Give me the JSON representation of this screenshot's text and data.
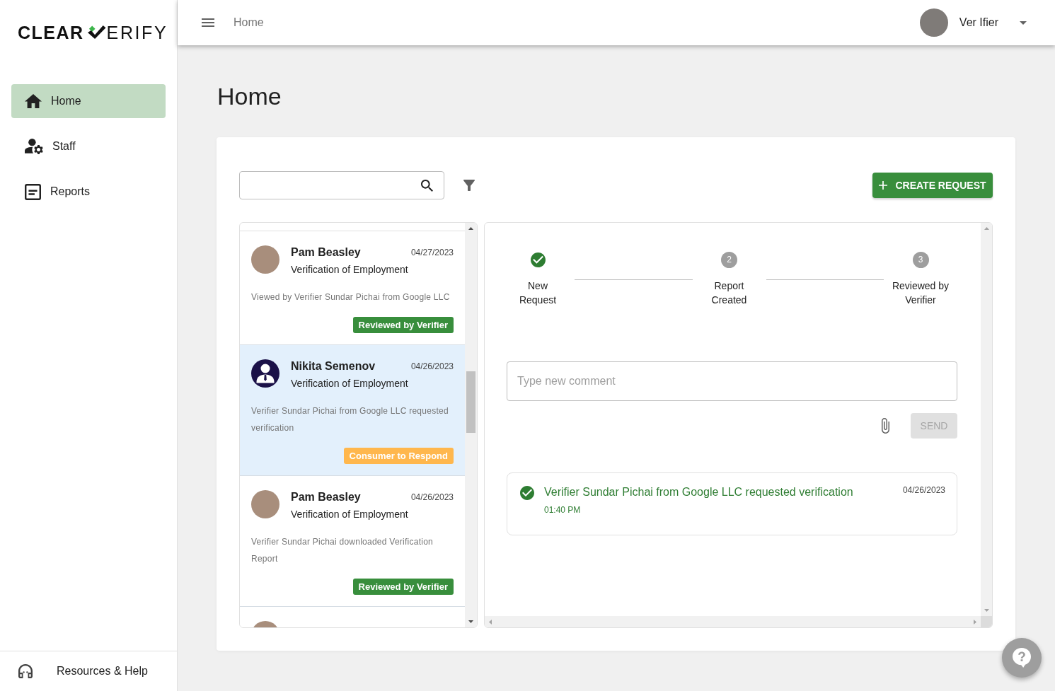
{
  "sidebar": {
    "logo": {
      "left": "CLEAR",
      "right": "ERIFY"
    },
    "nav": [
      {
        "label": "Home",
        "selected": true
      },
      {
        "label": "Staff",
        "selected": false
      },
      {
        "label": "Reports",
        "selected": false
      }
    ],
    "footer_link": "Resources & Help"
  },
  "topbar": {
    "breadcrumb": "Home",
    "user": {
      "name": "Ver Ifier"
    }
  },
  "page": {
    "title": "Home"
  },
  "toolbar": {
    "create_button": "CREATE REQUEST"
  },
  "requests": [
    {
      "name": "Pam Beasley",
      "date": "04/27/2023",
      "type": "Verification of Employment",
      "activity": "Viewed by Verifier Sundar Pichai from Google LLC",
      "status": {
        "label": "Reviewed by Verifier",
        "color": "#388e3c"
      },
      "avatar": {
        "kind": "photo"
      },
      "selected": false
    },
    {
      "name": "Nikita Semenov",
      "date": "04/26/2023",
      "type": "Verification of Employment",
      "activity": "Verifier Sundar Pichai from Google LLC requested verification",
      "status": {
        "label": "Consumer to Respond",
        "color": "#ffb74d"
      },
      "avatar": {
        "kind": "icon"
      },
      "selected": true
    },
    {
      "name": "Pam Beasley",
      "date": "04/26/2023",
      "type": "Verification of Employment",
      "activity": "Verifier Sundar Pichai downloaded Verification Report",
      "status": {
        "label": "Reviewed by Verifier",
        "color": "#388e3c"
      },
      "avatar": {
        "kind": "photo"
      },
      "selected": false
    },
    {
      "avatar": {
        "kind": "photo"
      },
      "selected": false
    }
  ],
  "detail": {
    "steps": [
      {
        "label_lines": [
          "New",
          "Request"
        ],
        "completed": true
      },
      {
        "number": "2",
        "label_lines": [
          "Report",
          "Created"
        ],
        "completed": false
      },
      {
        "number": "3",
        "label_lines": [
          "Reviewed by",
          "Verifier"
        ],
        "completed": false
      }
    ],
    "comment": {
      "placeholder": "Type new comment"
    },
    "send_button": {
      "label": "SEND",
      "disabled": true
    },
    "activities": [
      {
        "text": "Verifier Sundar Pichai from Google LLC requested verification",
        "time": "01:40 PM",
        "date": "04/26/2023"
      }
    ]
  }
}
